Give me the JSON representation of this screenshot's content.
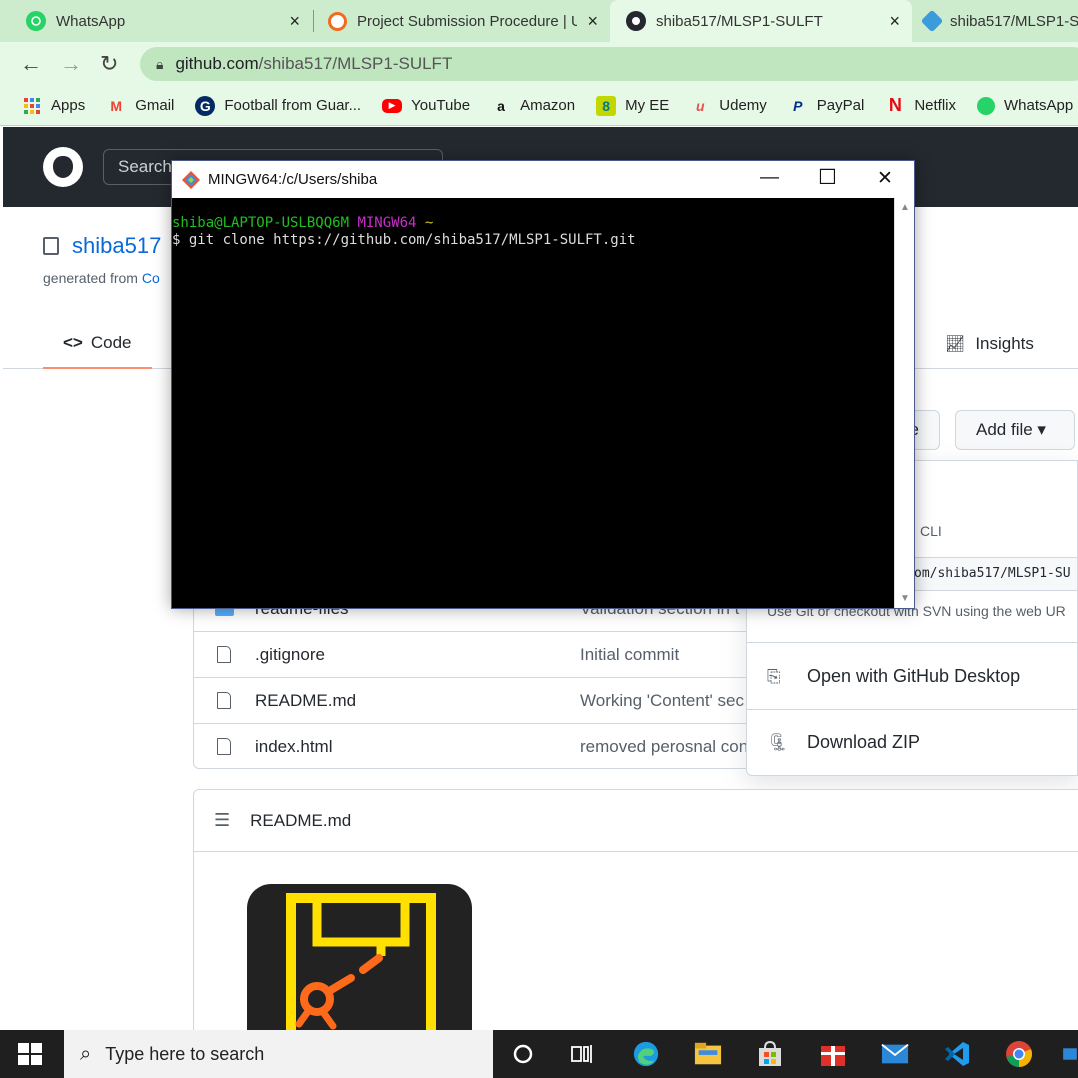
{
  "browser": {
    "tabs": [
      {
        "title": "WhatsApp",
        "icon": "whatsapp-icon",
        "active": false
      },
      {
        "title": "Project Submission Procedure | U",
        "icon": "udacity-icon",
        "active": false
      },
      {
        "title": "shiba517/MLSP1-SULFT",
        "icon": "github-icon",
        "active": true
      },
      {
        "title": "shiba517/MLSP1-S",
        "icon": "codesandbox-icon",
        "active": false
      }
    ],
    "close_glyph": "×",
    "address": {
      "host": "github.com",
      "path": "/shiba517/MLSP1-SULFT"
    },
    "bookmarks": [
      {
        "label": "Apps",
        "icon": "apps-grid-icon"
      },
      {
        "label": "Gmail",
        "icon": "gmail-icon"
      },
      {
        "label": "Football from Guar...",
        "icon": "guardian-icon"
      },
      {
        "label": "YouTube",
        "icon": "youtube-icon"
      },
      {
        "label": "Amazon",
        "icon": "amazon-icon"
      },
      {
        "label": "My EE",
        "icon": "ee-icon"
      },
      {
        "label": "Udemy",
        "icon": "udemy-icon"
      },
      {
        "label": "PayPal",
        "icon": "paypal-icon"
      },
      {
        "label": "Netflix",
        "icon": "netflix-icon"
      },
      {
        "label": "WhatsApp",
        "icon": "whatsapp-icon"
      }
    ]
  },
  "github": {
    "search_placeholder": "Search",
    "repo_owner": "shiba517",
    "generated_prefix": "generated from ",
    "generated_link": "Co",
    "tabs": {
      "code": "Code",
      "insights": "Insights"
    },
    "go_to_file_fragment": "e",
    "add_file": "Add file ▾",
    "files": [
      {
        "name": "readme-files",
        "message": "Validation section in t",
        "type": "folder"
      },
      {
        "name": ".gitignore",
        "message": "Initial commit",
        "type": "file"
      },
      {
        "name": "README.md",
        "message": "Working 'Content' sec",
        "type": "file"
      },
      {
        "name": "index.html",
        "message": "removed perosnal con",
        "type": "file"
      }
    ],
    "clone_panel": {
      "cli_fragment": "CLI",
      "url_fragment": "om/shiba517/MLSP1-SU",
      "hint": "Use Git or checkout with SVN using the web UR",
      "open_desktop": "Open with GitHub Desktop",
      "download_zip": "Download ZIP"
    },
    "readme_title": "README.md"
  },
  "terminal": {
    "title": "MINGW64:/c/Users/shiba",
    "prompt_user": "shiba@LAPTOP-USLBQQ6M",
    "prompt_env": "MINGW64",
    "prompt_dir": "~",
    "command_line": "$ git clone https://github.com/shiba517/MLSP1-SULFT.git",
    "controls": {
      "minimize": "—",
      "maximize": "☐",
      "close": "✕"
    }
  },
  "taskbar": {
    "search_placeholder": "Type here to search",
    "pinned": [
      "cortana-icon",
      "task-view-icon",
      "edge-icon",
      "file-explorer-icon",
      "store-icon",
      "gift-icon",
      "mail-icon",
      "vscode-icon",
      "chrome-icon"
    ]
  },
  "colors": {
    "chrome_tabbar": "#cdeccd",
    "chrome_toolbar": "#e6f8e6",
    "github_header": "#24292f",
    "github_link": "#0969da",
    "terminal_green": "#1fbf1f",
    "terminal_magenta": "#c72ec7"
  }
}
